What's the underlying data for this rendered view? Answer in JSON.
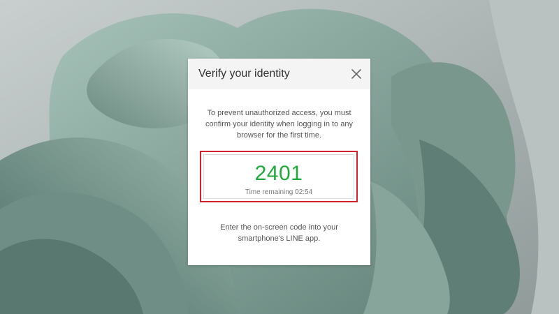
{
  "colors": {
    "accent_green": "#1eaa38",
    "highlight_red": "#d3212b",
    "header_bg": "#f4f4f4",
    "wallpaper_sage": "#7f9b92"
  },
  "dialog": {
    "title": "Verify your identity",
    "close_icon": "close-icon",
    "intro_text": "To prevent unauthorized access, you must confirm your identity when logging in to any browser for the first time.",
    "code": "2401",
    "timer_text": "Time remaining 02:54",
    "instruction_text": "Enter the on-screen code into your smartphone's LINE app."
  }
}
